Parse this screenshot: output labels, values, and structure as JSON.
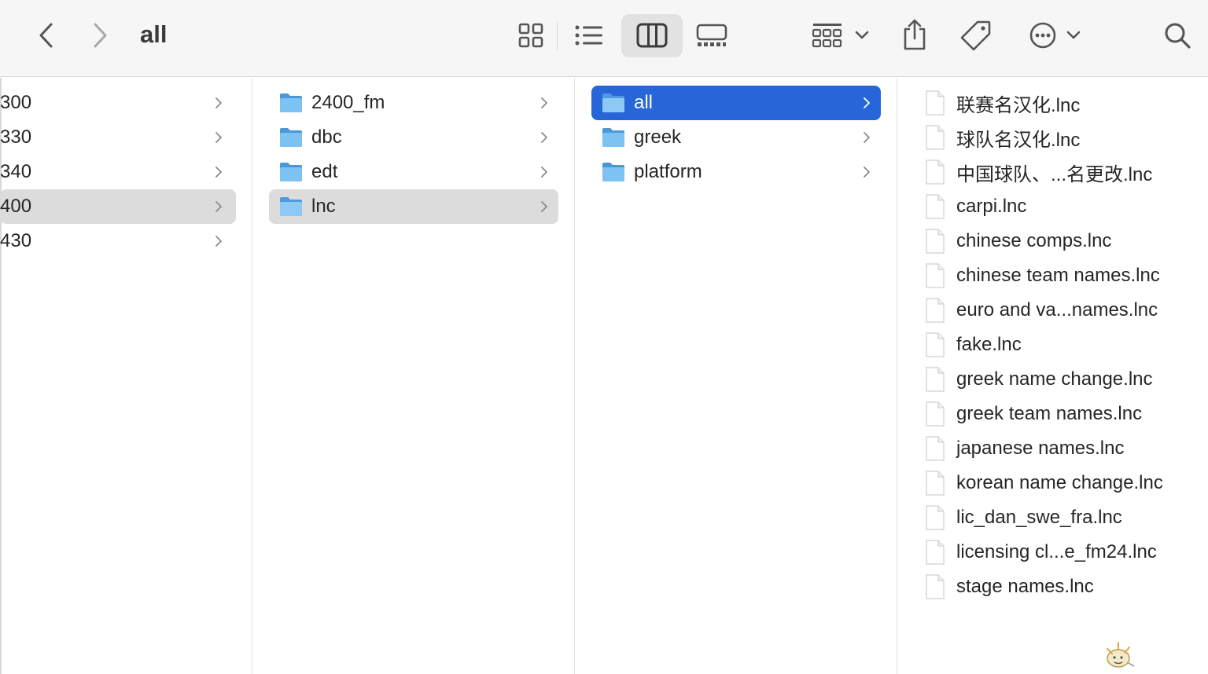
{
  "window": {
    "title": "all"
  },
  "toolbar": {
    "back": "chevron-left-icon",
    "forward": "chevron-right-icon",
    "views": [
      "icon-view-icon",
      "list-view-icon",
      "column-view-icon",
      "gallery-view-icon"
    ],
    "selected_view": "column-view",
    "group": "group-icon",
    "share": "share-icon",
    "tag": "tag-icon",
    "more": "ellipsis-circle-icon",
    "search": "search-icon"
  },
  "colors": {
    "selection_blue": "#2666d9",
    "selection_grey": "#dcdcdc",
    "folder": "#6fb8ec"
  },
  "columns": [
    {
      "items": [
        {
          "label": "300",
          "selected": false
        },
        {
          "label": "330",
          "selected": false
        },
        {
          "label": "340",
          "selected": false
        },
        {
          "label": "400",
          "selected": true
        },
        {
          "label": "430",
          "selected": false
        }
      ]
    },
    {
      "items": [
        {
          "label": "2400_fm",
          "selected": false
        },
        {
          "label": "dbc",
          "selected": false
        },
        {
          "label": "edt",
          "selected": false
        },
        {
          "label": "lnc",
          "selected": true
        }
      ]
    },
    {
      "items": [
        {
          "label": "all",
          "selected": true
        },
        {
          "label": "greek",
          "selected": false
        },
        {
          "label": "platform",
          "selected": false
        }
      ]
    },
    {
      "items": [
        {
          "label": "联赛名汉化.lnc"
        },
        {
          "label": "球队名汉化.lnc"
        },
        {
          "label": "中国球队、...名更改.lnc"
        },
        {
          "label": "carpi.lnc"
        },
        {
          "label": "chinese comps.lnc"
        },
        {
          "label": "chinese team names.lnc"
        },
        {
          "label": "euro and va...names.lnc"
        },
        {
          "label": "fake.lnc"
        },
        {
          "label": "greek name change.lnc"
        },
        {
          "label": "greek team names.lnc"
        },
        {
          "label": "japanese names.lnc"
        },
        {
          "label": "korean name change.lnc"
        },
        {
          "label": "lic_dan_swe_fra.lnc"
        },
        {
          "label": "licensing cl...e_fm24.lnc"
        },
        {
          "label": "stage names.lnc"
        }
      ]
    }
  ]
}
